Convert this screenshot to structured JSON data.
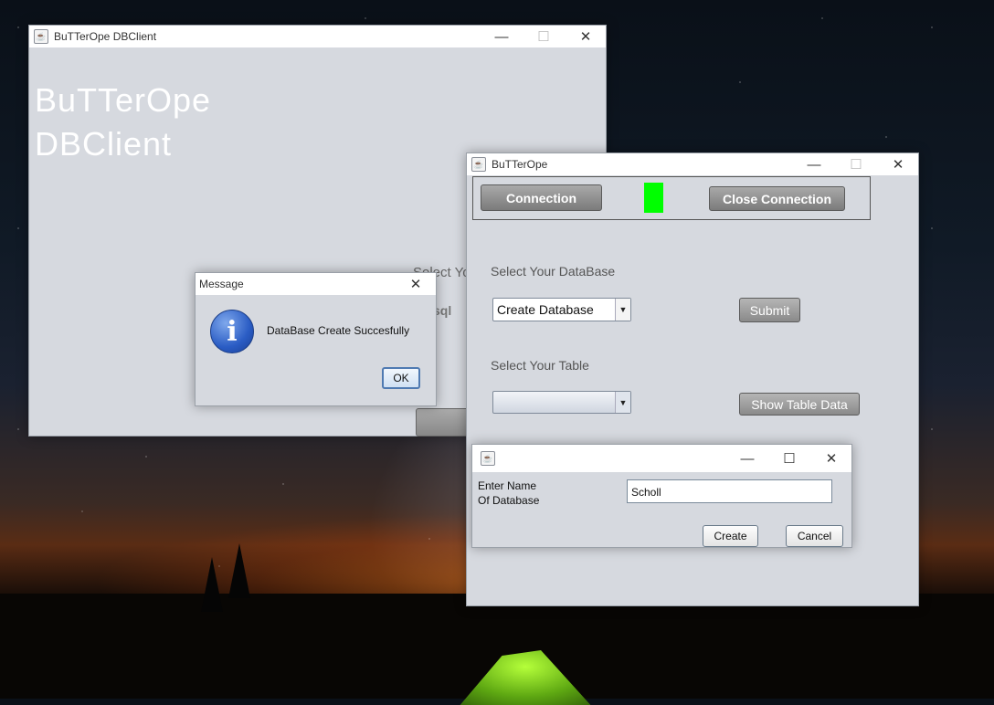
{
  "main_window": {
    "title": "BuTTerOpe DBClient",
    "heading_line1": "BuTTerOpe",
    "heading_line2": "DBClient",
    "partial_label": "Select Yo",
    "partial_text": "sql"
  },
  "butterope_window": {
    "title": "BuTTerOpe",
    "connection_button": "Connection",
    "close_connection_button": "Close Connection",
    "status_color": "#00ff00",
    "select_db_label": "Select Your DataBase",
    "db_combo_value": "Create Database",
    "submit_button": "Submit",
    "select_table_label": "Select Your Table",
    "table_combo_value": "",
    "show_table_button": "Show Table Data"
  },
  "message_dialog": {
    "title": "Message",
    "text": "DataBase Create Succesfully",
    "ok_button": "OK"
  },
  "create_dialog": {
    "title": "",
    "label_line1": "Enter Name",
    "label_line2": "Of Database",
    "name_value": "Scholl",
    "create_button": "Create",
    "cancel_button": "Cancel"
  },
  "icons": {
    "java": "java-icon",
    "info": "info-icon",
    "minimize": "minimize-icon",
    "maximize": "maximize-icon",
    "close": "close-icon",
    "dropdown": "chevron-down-icon"
  }
}
